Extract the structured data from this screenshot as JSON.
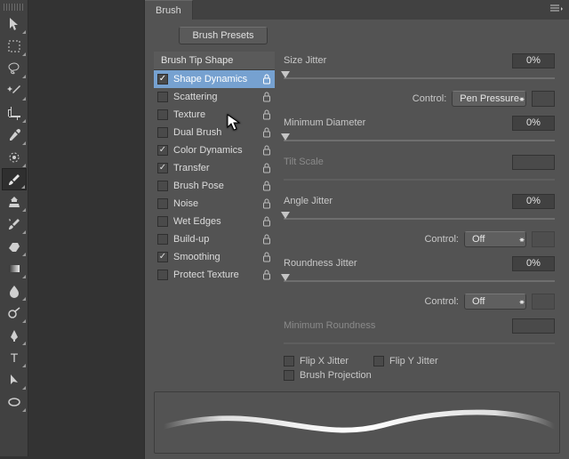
{
  "panel": {
    "tab": "Brush",
    "presets_button": "Brush Presets",
    "tip_shape_header": "Brush Tip Shape",
    "options": [
      {
        "label": "Shape Dynamics",
        "checked": true,
        "selected": true
      },
      {
        "label": "Scattering",
        "checked": false,
        "selected": false
      },
      {
        "label": "Texture",
        "checked": false,
        "selected": false
      },
      {
        "label": "Dual Brush",
        "checked": false,
        "selected": false
      },
      {
        "label": "Color Dynamics",
        "checked": true,
        "selected": false
      },
      {
        "label": "Transfer",
        "checked": true,
        "selected": false
      },
      {
        "label": "Brush Pose",
        "checked": false,
        "selected": false
      },
      {
        "label": "Noise",
        "checked": false,
        "selected": false
      },
      {
        "label": "Wet Edges",
        "checked": false,
        "selected": false
      },
      {
        "label": "Build-up",
        "checked": false,
        "selected": false
      },
      {
        "label": "Smoothing",
        "checked": true,
        "selected": false
      },
      {
        "label": "Protect Texture",
        "checked": false,
        "selected": false
      }
    ]
  },
  "shape": {
    "size_jitter": {
      "label": "Size Jitter",
      "value": "0%"
    },
    "size_control": {
      "label": "Control:",
      "value": "Pen Pressure"
    },
    "min_diameter": {
      "label": "Minimum Diameter",
      "value": "0%"
    },
    "tilt_scale": {
      "label": "Tilt Scale",
      "value": ""
    },
    "angle_jitter": {
      "label": "Angle Jitter",
      "value": "0%"
    },
    "angle_control": {
      "label": "Control:",
      "value": "Off"
    },
    "roundness_jitter": {
      "label": "Roundness Jitter",
      "value": "0%"
    },
    "roundness_control": {
      "label": "Control:",
      "value": "Off"
    },
    "min_roundness": {
      "label": "Minimum Roundness",
      "value": ""
    },
    "flip_x": "Flip X Jitter",
    "flip_y": "Flip Y Jitter",
    "brush_projection": "Brush Projection"
  },
  "tools": [
    "move",
    "rect-marquee",
    "lasso",
    "magic-wand",
    "crop",
    "eyedropper",
    "spot-heal",
    "brush",
    "clone-stamp",
    "history-brush",
    "eraser",
    "gradient",
    "blur",
    "dodge",
    "pen",
    "type",
    "path-select",
    "ellipse"
  ]
}
